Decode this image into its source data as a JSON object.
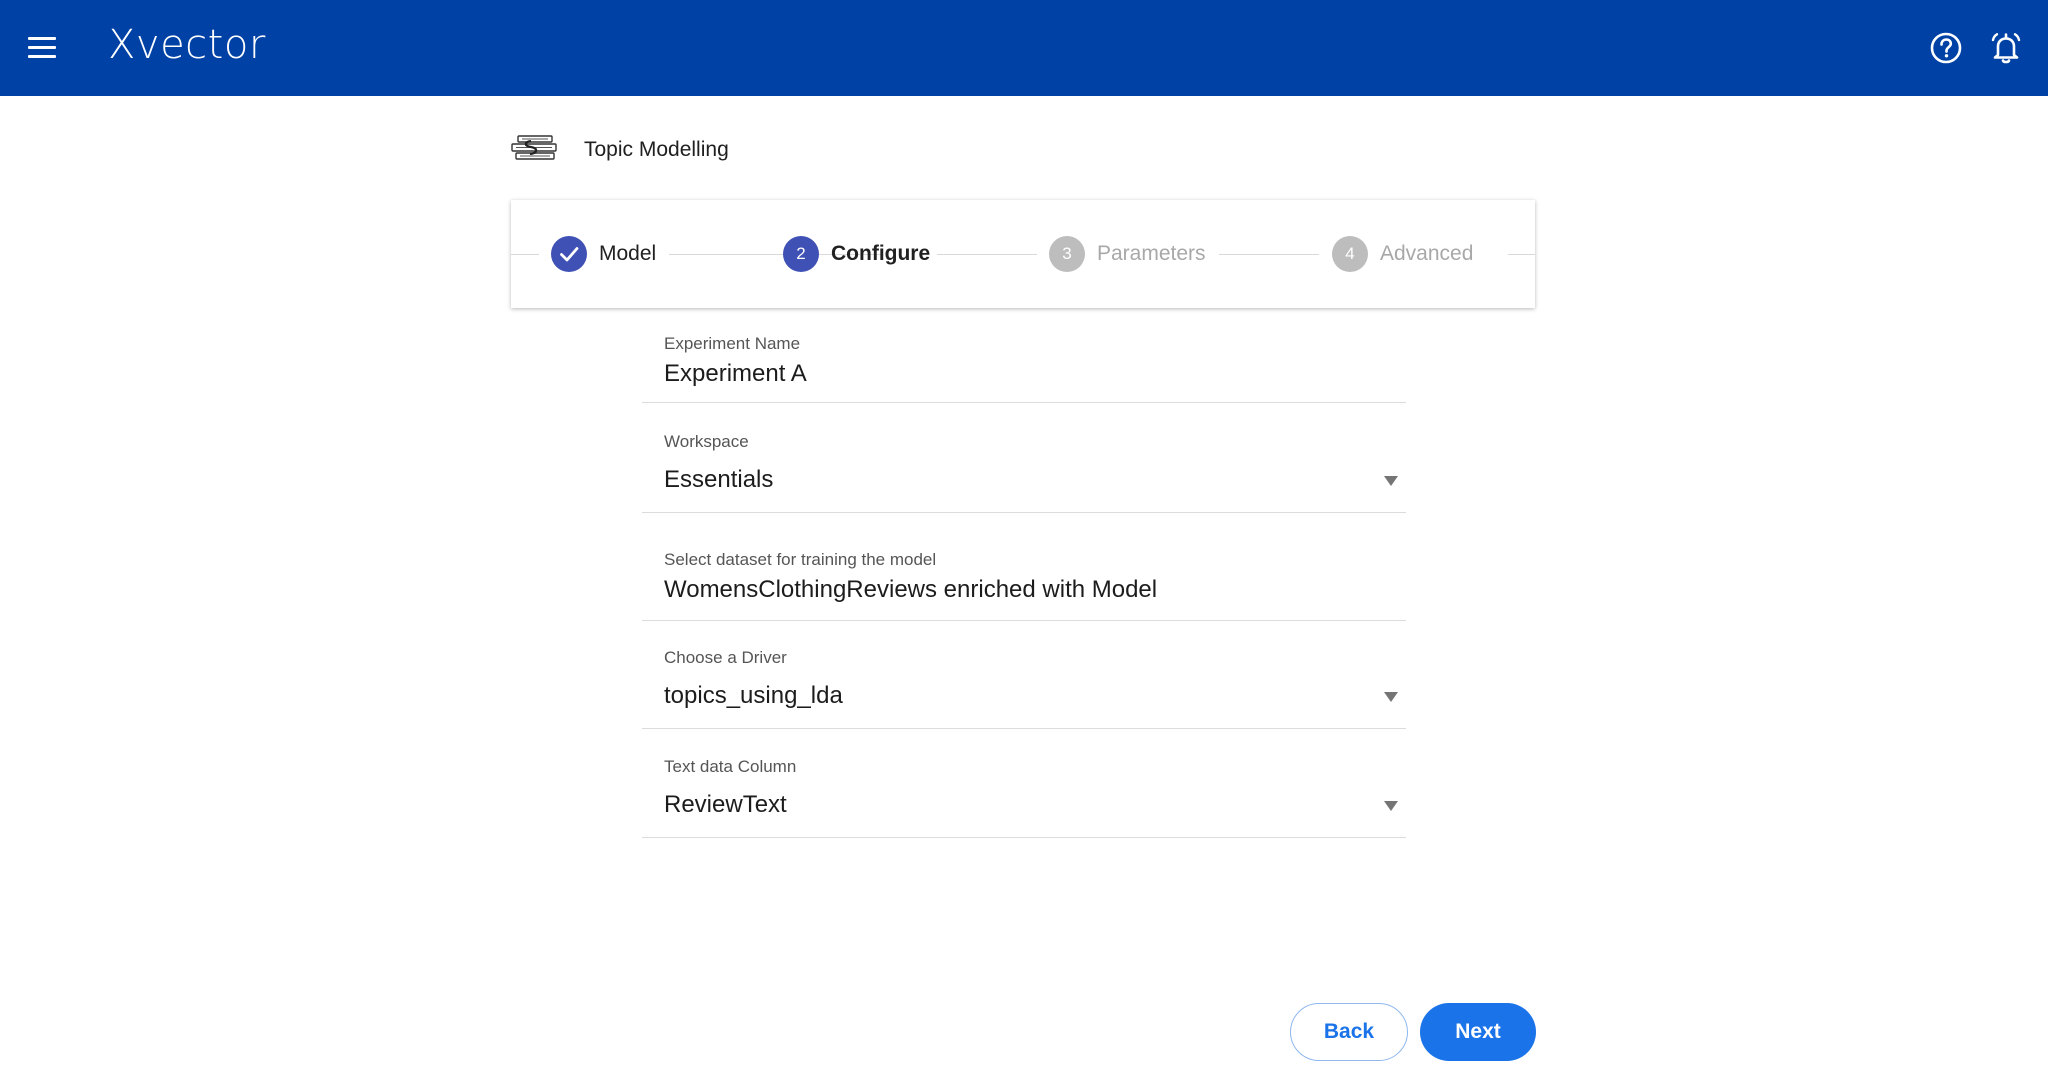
{
  "app": {
    "name": "Xvector"
  },
  "page": {
    "title": "Topic Modelling"
  },
  "stepper": {
    "steps": [
      {
        "number": "1",
        "label": "Model",
        "state": "completed"
      },
      {
        "number": "2",
        "label": "Configure",
        "state": "current"
      },
      {
        "number": "3",
        "label": "Parameters",
        "state": "upcoming"
      },
      {
        "number": "4",
        "label": "Advanced",
        "state": "upcoming"
      }
    ]
  },
  "form": {
    "experiment_name": {
      "label": "Experiment Name",
      "value": "Experiment A"
    },
    "workspace": {
      "label": "Workspace",
      "value": "Essentials"
    },
    "dataset": {
      "label": "Select dataset for training the model",
      "value": "WomensClothingReviews enriched with Model"
    },
    "driver": {
      "label": "Choose a Driver",
      "value": "topics_using_lda"
    },
    "text_column": {
      "label": "Text data Column",
      "value": "ReviewText"
    }
  },
  "actions": {
    "back_label": "Back",
    "next_label": "Next"
  },
  "colors": {
    "topbar": "#0041a5",
    "step_active": "#3f51b5",
    "step_inactive": "#bdbdbd",
    "primary_button": "#1a73e8"
  },
  "icons": {
    "menu": "menu-icon",
    "help": "help-circle-icon",
    "notifications": "bell-icon",
    "model": "topic-model-icon",
    "step_done": "check-icon",
    "dropdown": "caret-down-icon"
  }
}
